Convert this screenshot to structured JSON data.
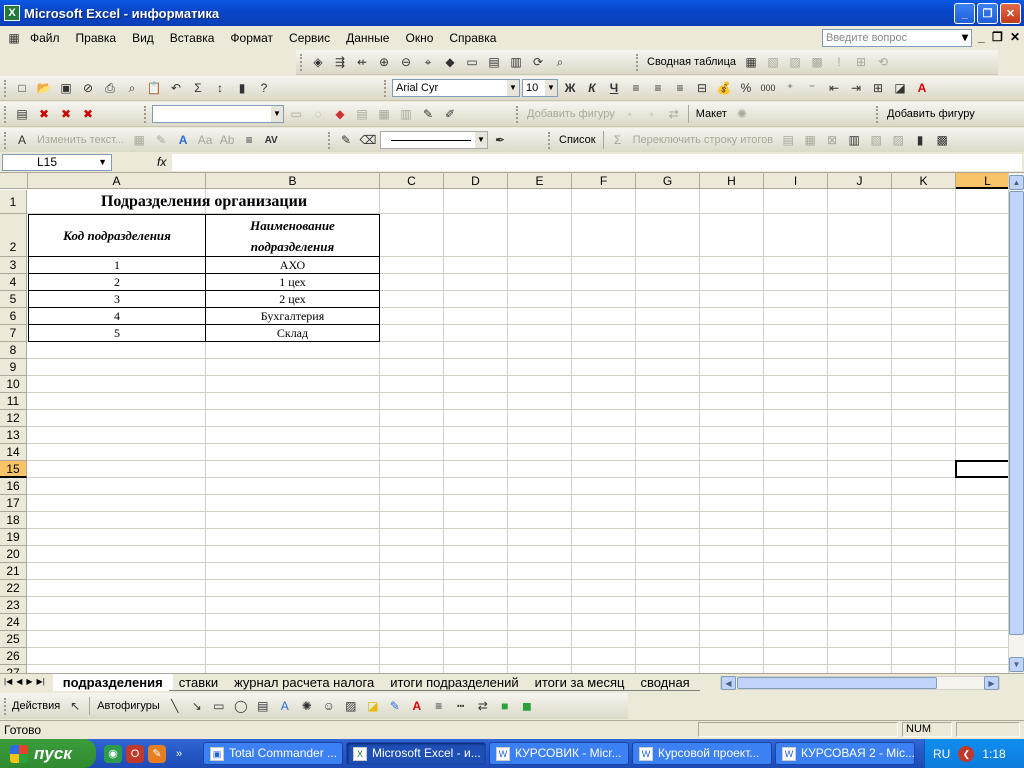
{
  "window": {
    "title": "Microsoft Excel - информатика"
  },
  "menu": {
    "items": [
      "Файл",
      "Правка",
      "Вид",
      "Вставка",
      "Формат",
      "Сервис",
      "Данные",
      "Окно",
      "Справка"
    ],
    "ask_placeholder": "Введите вопрос"
  },
  "toolbars": {
    "pivot_label": "Сводная таблица",
    "font_name": "Arial Cyr",
    "font_size": "10",
    "bold": "Ж",
    "italic": "К",
    "underline": "Ч",
    "add_shape_1": "Добавить фигуру",
    "layout": "Макет",
    "add_shape_2": "Добавить фигуру",
    "edit_text": "Изменить текст...",
    "list": "Список",
    "toggle_totals": "Переключить строку итогов"
  },
  "formula_bar": {
    "name_box": "L15",
    "fx": "fx",
    "value": ""
  },
  "sheet": {
    "columns": [
      "A",
      "B",
      "C",
      "D",
      "E",
      "F",
      "G",
      "H",
      "I",
      "J",
      "K",
      "L"
    ],
    "rows": [
      "1",
      "2",
      "3",
      "4",
      "5",
      "6",
      "7",
      "8",
      "9",
      "10",
      "11",
      "12",
      "13",
      "14",
      "15",
      "16",
      "17",
      "18",
      "19",
      "20",
      "21",
      "22",
      "23",
      "24",
      "25",
      "26",
      "27"
    ],
    "selected_column": "L",
    "selected_row": "15",
    "table_title": "Подразделения организации",
    "header_code": "Код подразделения",
    "header_name": "Наименование подразделения",
    "records": [
      {
        "code": "1",
        "name": "АХО"
      },
      {
        "code": "2",
        "name": "1 цех"
      },
      {
        "code": "3",
        "name": "2 цех"
      },
      {
        "code": "4",
        "name": "Бухгалтерия"
      },
      {
        "code": "5",
        "name": "Склад"
      }
    ]
  },
  "sheet_tabs": [
    "подразделения",
    "ставки",
    "журнал расчета налога",
    "итоги подразделений",
    "итоги за месяц",
    "сводная"
  ],
  "active_tab": "подразделения",
  "drawing": {
    "actions": "Действия",
    "autoshapes": "Автофигуры"
  },
  "status": {
    "ready": "Готово",
    "num": "NUM"
  },
  "taskbar": {
    "start": "пуск",
    "tasks": [
      "Total Commander ...",
      "Microsoft Excel - и...",
      "КУРСОВИК - Micr...",
      "Курсовой проект...",
      "КУРСОВАЯ 2 - Mic..."
    ],
    "lang": "RU",
    "clock": "1:18"
  }
}
